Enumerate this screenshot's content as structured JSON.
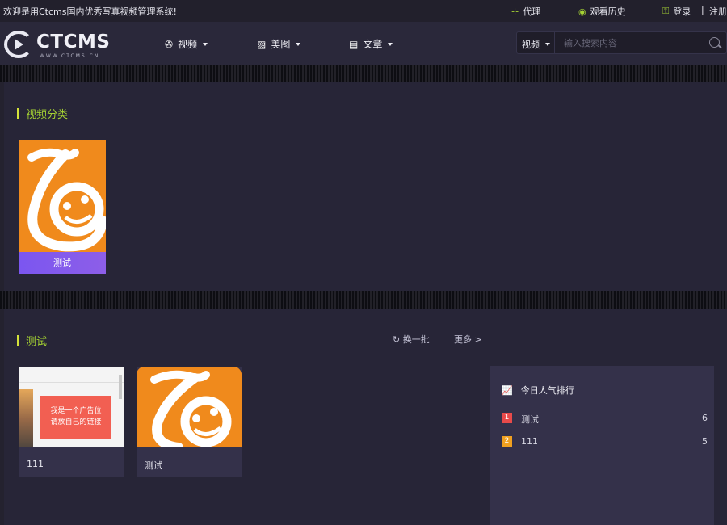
{
  "topbar": {
    "welcome": "欢迎是用Ctcms国内优秀写真视频管理系统!",
    "agent": "代理",
    "history": "观看历史",
    "login": "登录",
    "divider": "|",
    "register": "注册"
  },
  "logo": {
    "word": "CTCMS",
    "sub": "WWW.CTCMS.CN"
  },
  "nav": [
    {
      "label": "视频",
      "icon": "film-reel-icon"
    },
    {
      "label": "美图",
      "icon": "image-icon"
    },
    {
      "label": "文章",
      "icon": "document-icon"
    }
  ],
  "search": {
    "type": "视频",
    "placeholder": "输入搜索内容"
  },
  "category_section": {
    "title": "视频分类",
    "items": [
      {
        "caption": "测试"
      }
    ]
  },
  "test_section": {
    "title": "测试",
    "refresh": "换一批",
    "more": "更多 >",
    "videos": [
      {
        "title": "111",
        "ad_text_1": "我是一个广告位",
        "ad_text_2": "请放自己的链接"
      },
      {
        "title": "测试"
      }
    ]
  },
  "ranking": {
    "title": "今日人气排行",
    "items": [
      {
        "rank": "1",
        "name": "测试",
        "count": "6",
        "color": "#e84a4a"
      },
      {
        "rank": "2",
        "name": "111",
        "count": "5",
        "color": "#f0a020"
      }
    ]
  },
  "colors": {
    "accent": "#a5d233",
    "card_caption": "#7b56f0",
    "logo_orange": "#f08a1c"
  }
}
